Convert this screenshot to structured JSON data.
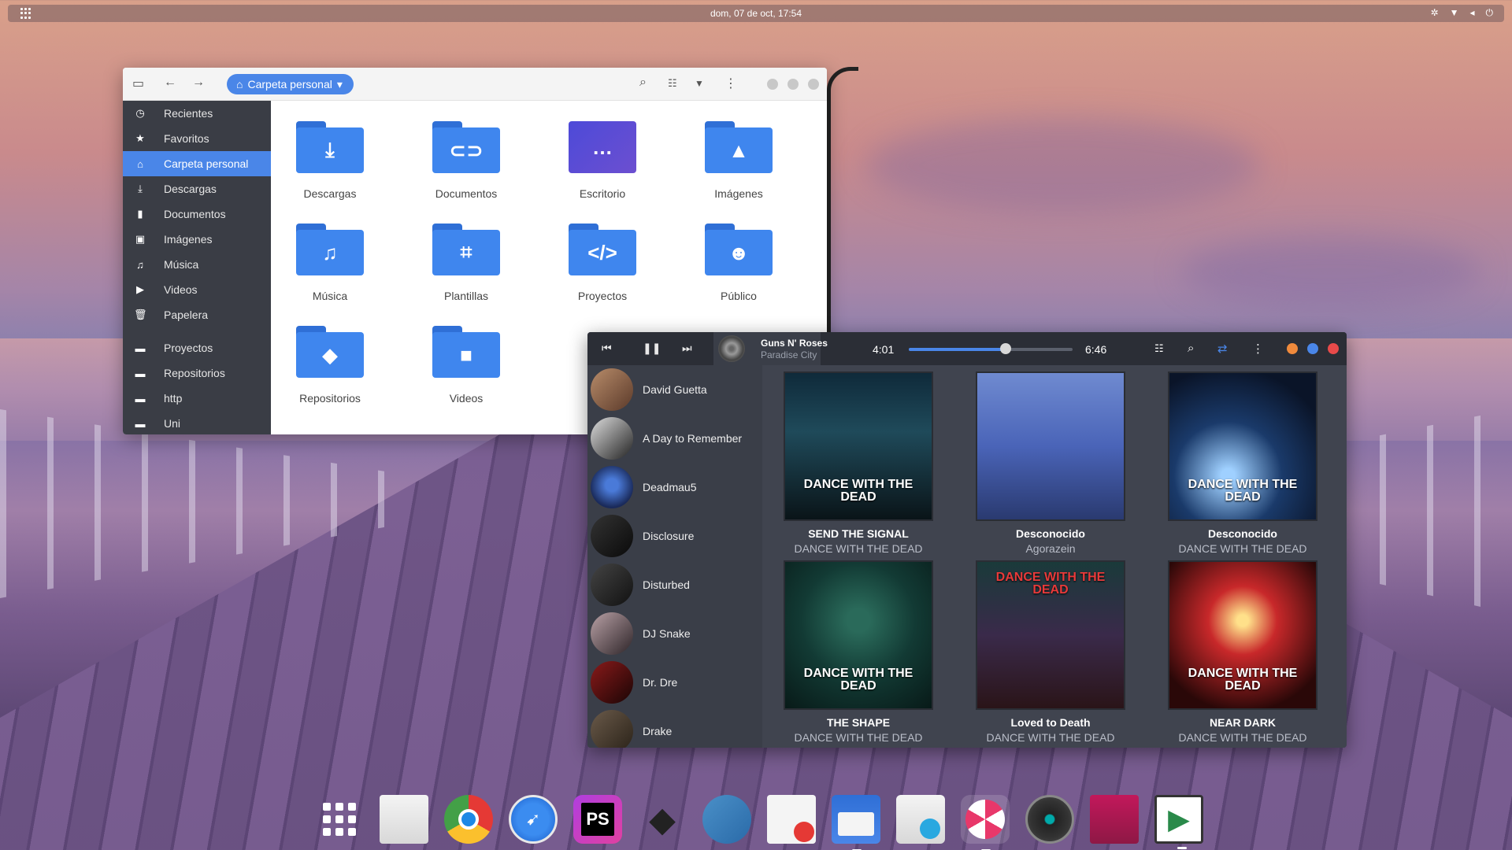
{
  "topbar": {
    "clock": "dom, 07 de oct, 17:54"
  },
  "file_manager": {
    "breadcrumb": "Carpeta personal",
    "sidebar": [
      {
        "label": "Recientes",
        "icon": "clock-icon"
      },
      {
        "label": "Favoritos",
        "icon": "star-icon"
      },
      {
        "label": "Carpeta personal",
        "icon": "home-icon",
        "active": true
      },
      {
        "label": "Descargas",
        "icon": "download-icon"
      },
      {
        "label": "Documentos",
        "icon": "document-icon"
      },
      {
        "label": "Imágenes",
        "icon": "image-icon"
      },
      {
        "label": "Música",
        "icon": "music-icon"
      },
      {
        "label": "Videos",
        "icon": "video-icon"
      },
      {
        "label": "Papelera",
        "icon": "trash-icon"
      },
      {
        "label": "Proyectos",
        "icon": "folder-icon"
      },
      {
        "label": "Repositorios",
        "icon": "folder-icon"
      },
      {
        "label": "http",
        "icon": "folder-icon"
      },
      {
        "label": "Uni",
        "icon": "folder-icon"
      }
    ],
    "folders": [
      {
        "label": "Descargas",
        "icon": "download-folder-icon"
      },
      {
        "label": "Documentos",
        "icon": "documents-folder-icon"
      },
      {
        "label": "Escritorio",
        "icon": "desktop-folder-icon"
      },
      {
        "label": "Imágenes",
        "icon": "pictures-folder-icon"
      },
      {
        "label": "Música",
        "icon": "music-folder-icon"
      },
      {
        "label": "Plantillas",
        "icon": "templates-folder-icon"
      },
      {
        "label": "Proyectos",
        "icon": "projects-folder-icon"
      },
      {
        "label": "Público",
        "icon": "public-folder-icon"
      },
      {
        "label": "Repositorios",
        "icon": "repositories-folder-icon"
      },
      {
        "label": "Videos",
        "icon": "videos-folder-icon"
      }
    ]
  },
  "player": {
    "now_playing": {
      "artist": "Guns N' Roses",
      "song": "Paradise City"
    },
    "time_current": "4:01",
    "time_total": "6:46",
    "progress": 0.59,
    "artists": [
      "David Guetta",
      "A Day to Remember",
      "Deadmau5",
      "Disclosure",
      "Disturbed",
      "DJ Snake",
      "Dr. Dre",
      "Drake"
    ],
    "albums": [
      {
        "title": "SEND THE SIGNAL",
        "artist": "DANCE WITH THE DEAD",
        "cover_text": "DANCE WITH THE DEAD"
      },
      {
        "title": "Desconocido",
        "artist": "Agorazein",
        "cover_text": ""
      },
      {
        "title": "Desconocido",
        "artist": "DANCE WITH THE DEAD",
        "cover_text": "DANCE WITH THE DEAD"
      },
      {
        "title": "THE SHAPE",
        "artist": "DANCE WITH THE DEAD",
        "cover_text": "DANCE WITH THE DEAD"
      },
      {
        "title": "Loved to Death",
        "artist": "DANCE WITH THE DEAD",
        "cover_text": "DANCE WITH THE DEAD"
      },
      {
        "title": "NEAR DARK",
        "artist": "DANCE WITH THE DEAD",
        "cover_text": "DANCE WITH THE DEAD"
      }
    ]
  },
  "dock": [
    {
      "name": "app-grid-icon"
    },
    {
      "name": "mail-icon"
    },
    {
      "name": "chrome-icon"
    },
    {
      "name": "safari-icon"
    },
    {
      "name": "phpstorm-icon",
      "glyph": "PS"
    },
    {
      "name": "inkscape-icon"
    },
    {
      "name": "ferdi-icon"
    },
    {
      "name": "text-editor-icon"
    },
    {
      "name": "files-icon"
    },
    {
      "name": "software-center-icon"
    },
    {
      "name": "music-player-icon"
    },
    {
      "name": "disk-player-icon"
    },
    {
      "name": "document-viewer-icon"
    },
    {
      "name": "play-store-icon"
    }
  ]
}
